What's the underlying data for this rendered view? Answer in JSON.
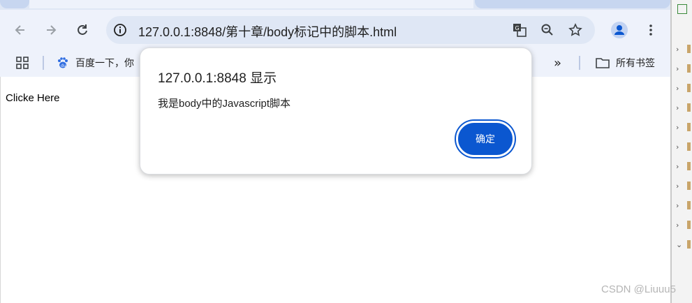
{
  "browser": {
    "url": "127.0.0.1:8848/第十章/body标记中的脚本.html",
    "bookmarks": [
      {
        "label": "百度一下，你"
      },
      {
        "label": "所有书签"
      }
    ],
    "overflow_label": "»"
  },
  "page": {
    "link_text": "Clicke Here"
  },
  "alert": {
    "title": "127.0.0.1:8848 显示",
    "message": "我是body中的Javascript脚本",
    "ok_label": "确定"
  },
  "watermark": "CSDN @Liuuu5",
  "colors": {
    "accent": "#0b57d0",
    "toolbar_bg": "#eef2fb",
    "omnibox_bg": "#dfe7f5"
  },
  "icons": [
    "back-icon",
    "forward-icon",
    "reload-icon",
    "site-info-icon",
    "translate-icon",
    "zoom-icon",
    "star-icon",
    "profile-icon",
    "menu-icon",
    "apps-icon",
    "baidu-icon",
    "folder-icon"
  ]
}
